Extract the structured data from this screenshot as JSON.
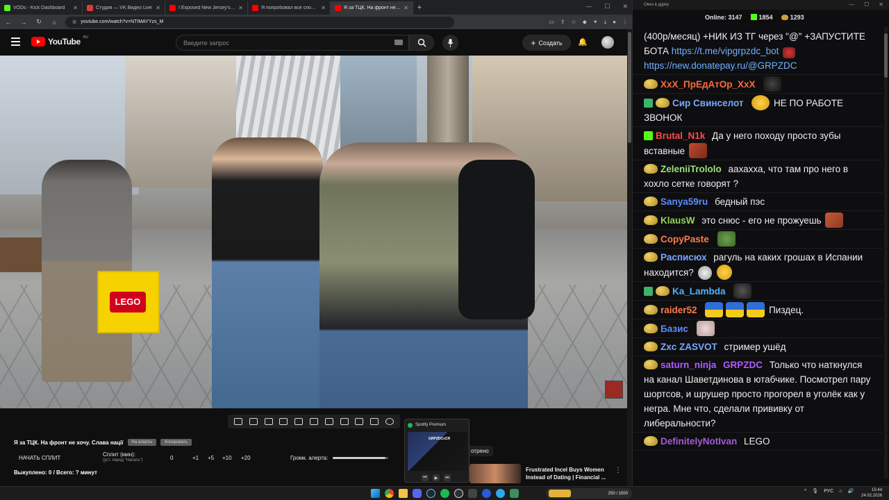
{
  "browser": {
    "tabs": [
      {
        "title": "VODs - Kick Dashboard",
        "color": "#53fc18",
        "active": false
      },
      {
        "title": "Студия — VK Видео Live",
        "color": "#e53935",
        "active": false
      },
      {
        "title": "I Exposed New Jersey's Jewish",
        "color": "#ff0000",
        "active": false
      },
      {
        "title": "Я попробовал все способы б",
        "color": "#ff0000",
        "active": false
      },
      {
        "title": "Я за ТЦК. На фронт не хочу. С",
        "color": "#ff0000",
        "active": true
      }
    ],
    "url": "youtube.com/watch?v=NTIMAYYzs_M"
  },
  "youtube": {
    "logo_text": "YouTube",
    "region": "RU",
    "search_placeholder": "Введите запрос",
    "create_label": "Создать"
  },
  "video": {
    "title": "Я за ТЦК. На фронт не хочу. Слава нації",
    "pill_1": "На алерты",
    "pill_2": "Копировать",
    "split_button": "НАЧАТЬ СПЛИТ",
    "split_label": "Сплит (мин):",
    "split_sub": "(уст. перед \"Начать\")",
    "split_values": [
      "0",
      "+1",
      "+5",
      "+10",
      "+20"
    ],
    "alert_volume_label": "Громк. алерта:",
    "alert_volume_level": 0.95,
    "bought": "Выкуплено: 0 / Всего: ? минут"
  },
  "spotify": {
    "header": "Spotify Premium",
    "thumb_text": "GRPZDCxCR"
  },
  "recommendation": {
    "watched_badge": "отрено",
    "title": "Frustrated Incel Buys Women Instead of Dating | Financial ..."
  },
  "chat": {
    "window_title": "Окно в дурку",
    "online_label": "Online:",
    "online_count": "3147",
    "kick_count": "1854",
    "coin_count": "1293",
    "messages": [
      {
        "user": "",
        "color": "#efeff1",
        "text": "(400р/месяц) +НИК ИЗ ТГ через \"@\" +ЗАПУСТИТЕ БОТА",
        "link1": "https://t.me/vipgrpzdc_bot",
        "link2": "https://new.donatepay.ru/@GRPZDC"
      },
      {
        "user": "XxX_ПрЕдАтОр_XxX",
        "color": "#ff6a3d",
        "text": ""
      },
      {
        "user": "Сир Свинселот",
        "color": "#7aa7ff",
        "text": "НЕ ПО РАБОТЕ ЗВОНОК"
      },
      {
        "user": "Brutal_N1k",
        "color": "#ff4a4a",
        "text": "Да у него походу просто зубы вставные"
      },
      {
        "user": "ZeleniiTrololo",
        "color": "#9be07a",
        "text": "аахахха, что там про него в хохло сетке говорят ?"
      },
      {
        "user": "Sanya59ru",
        "color": "#5a8cff",
        "text": "бедный пэс"
      },
      {
        "user": "KlausW",
        "color": "#8fd65a",
        "text": "это снюс - его не прожуешь"
      },
      {
        "user": "CopyPaste",
        "color": "#ff7a4a",
        "text": ""
      },
      {
        "user": "Расписюх",
        "color": "#7aa7ff",
        "text": "рагуль на каких грошах в Испании находится?"
      },
      {
        "user": "Ka_Lambda",
        "color": "#4fb3ff",
        "text": ""
      },
      {
        "user": "raider52",
        "color": "#ff7a4a",
        "text": "Пиздец."
      },
      {
        "user": "Базис",
        "color": "#5a8cff",
        "text": ""
      },
      {
        "user": "Zxc ZASVOT",
        "color": "#7aa7ff",
        "text": "стример ушёд"
      },
      {
        "user": "saturn_ninja",
        "color": "#b05cff",
        "text": "Только что наткнулся на канал Шаветдинова в ютабчике. Посмотрел пару шортсов, и шрушер просто прогорел в уголёк как у негра. Мне что, сделали прививку от либеральности?",
        "mention": "GRPZDC"
      },
      {
        "user": "DefinitelyNotIvan",
        "color": "#a35bd8",
        "text": "LEGO"
      }
    ]
  },
  "taskbar": {
    "lang": "РУС",
    "time": "15:44",
    "date": "24.02.2026",
    "tray_counter": "250 / 1500"
  }
}
